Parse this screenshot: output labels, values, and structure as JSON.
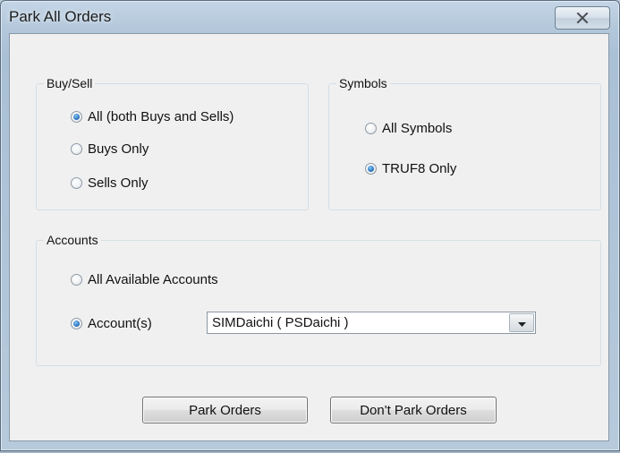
{
  "window": {
    "title": "Park All Orders"
  },
  "buy_sell": {
    "label": "Buy/Sell",
    "options": [
      {
        "label": "All  (both Buys and Sells)",
        "checked": true
      },
      {
        "label": "Buys Only",
        "checked": false
      },
      {
        "label": "Sells Only",
        "checked": false
      }
    ]
  },
  "symbols": {
    "label": "Symbols",
    "options": [
      {
        "label": "All Symbols",
        "checked": false
      },
      {
        "label": "TRUF8 Only",
        "checked": true
      }
    ]
  },
  "accounts": {
    "label": "Accounts",
    "all_label": "All Available Accounts",
    "all_checked": false,
    "specific_label": "Account(s)",
    "specific_checked": true,
    "selected_account": "SIMDaichi ( PSDaichi )"
  },
  "buttons": {
    "park": "Park Orders",
    "dont_park": "Don't Park Orders"
  },
  "icons": {
    "close": "close-icon",
    "dropdown": "chevron-down-icon"
  },
  "colors": {
    "radio_selected": "#2f7bc4",
    "dialog_background": "#f0f0f0"
  }
}
